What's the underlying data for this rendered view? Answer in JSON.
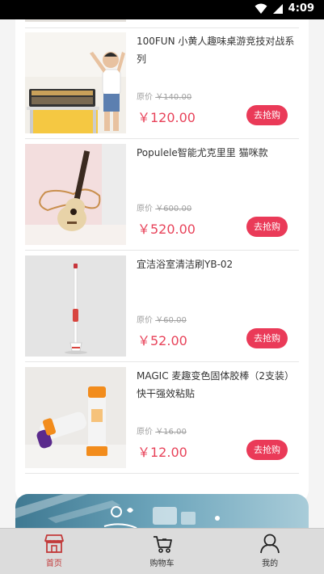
{
  "status_bar": {
    "time": "4:09"
  },
  "products": [
    {
      "title": "100FUN 小黄人趣味桌游竞技对战系列",
      "original_label": "原价",
      "original_price": "￥140.00",
      "price": "￥120.00",
      "button": "去抢购",
      "image": "kids-table-game-photo"
    },
    {
      "title": "Populele智能尤克里里 猫咪款",
      "original_label": "原价",
      "original_price": "￥600.00",
      "price": "￥520.00",
      "button": "去抢购",
      "image": "ukulele-photo"
    },
    {
      "title": "宜洁浴室清洁刷YB-02",
      "original_label": "原价",
      "original_price": "￥60.00",
      "price": "￥52.00",
      "button": "去抢购",
      "image": "cleaning-brush-photo"
    },
    {
      "title": "MAGIC 麦趣变色固体胶棒（2支装）快干强效粘贴",
      "original_label": "原价",
      "original_price": "￥16.00",
      "price": "￥12.00",
      "button": "去抢购",
      "image": "glue-stick-photo"
    }
  ],
  "tabbar": {
    "items": [
      {
        "label": "首页",
        "icon": "shop-icon",
        "active": true
      },
      {
        "label": "购物车",
        "icon": "cart-icon",
        "active": false
      },
      {
        "label": "我的",
        "icon": "person-icon",
        "active": false
      }
    ]
  },
  "colors": {
    "accent": "#ea3a58",
    "price": "#e8435a",
    "active_tab": "#c23a3a"
  }
}
